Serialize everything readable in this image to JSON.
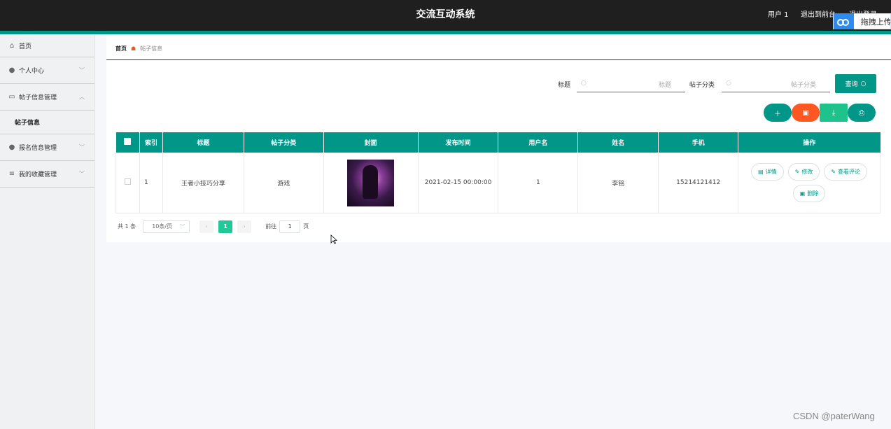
{
  "header": {
    "title": "交流互动系统",
    "user": "用户 1",
    "back_to_front": "退出到前台",
    "logout": "退出登录"
  },
  "upload_widget": {
    "label": "拖拽上传"
  },
  "sidebar": {
    "items": [
      {
        "label": "首页",
        "icon": "home-icon"
      },
      {
        "label": "个人中心",
        "icon": "user-icon"
      },
      {
        "label": "帖子信息管理",
        "icon": "card-icon"
      },
      {
        "label": "帖子信息",
        "icon": ""
      },
      {
        "label": "报名信息管理",
        "icon": "user-icon"
      },
      {
        "label": "我的收藏管理",
        "icon": "list-icon"
      }
    ]
  },
  "breadcrumb": {
    "home": "首页",
    "current": "帖子信息"
  },
  "search": {
    "title_label": "标题",
    "title_placeholder": "标题",
    "category_label": "帖子分类",
    "category_placeholder": "帖子分类",
    "query_label": "查询"
  },
  "actions": {
    "add_icon": "plus-icon",
    "delete_icon": "trash-icon",
    "export_icon": "download-icon",
    "print_icon": "print-icon",
    "colors": {
      "add": "#009688",
      "delete": "#ff5722",
      "export": "#1ec28b",
      "print": "#009688"
    }
  },
  "table": {
    "headers": [
      "索引",
      "标题",
      "帖子分类",
      "封面",
      "发布时间",
      "用户名",
      "姓名",
      "手机",
      "操作"
    ],
    "rows": [
      {
        "index": "1",
        "title": "王者小技巧分享",
        "category": "游戏",
        "publish_time": "2021-02-15 00:00:00",
        "username": "1",
        "name": "李铭",
        "phone": "15214121412"
      }
    ],
    "row_actions": [
      "详情",
      "修改",
      "查看评论",
      "删除"
    ]
  },
  "pagination": {
    "total": "共 1 条",
    "page_size": "10条/页",
    "current_page": "1",
    "goto_label": "前往",
    "goto_value": "1",
    "page_word": "页"
  },
  "watermark": "CSDN @paterWang",
  "colors": {
    "primary": "#009688",
    "danger": "#ff5722",
    "topbar": "#1f1f1f"
  }
}
